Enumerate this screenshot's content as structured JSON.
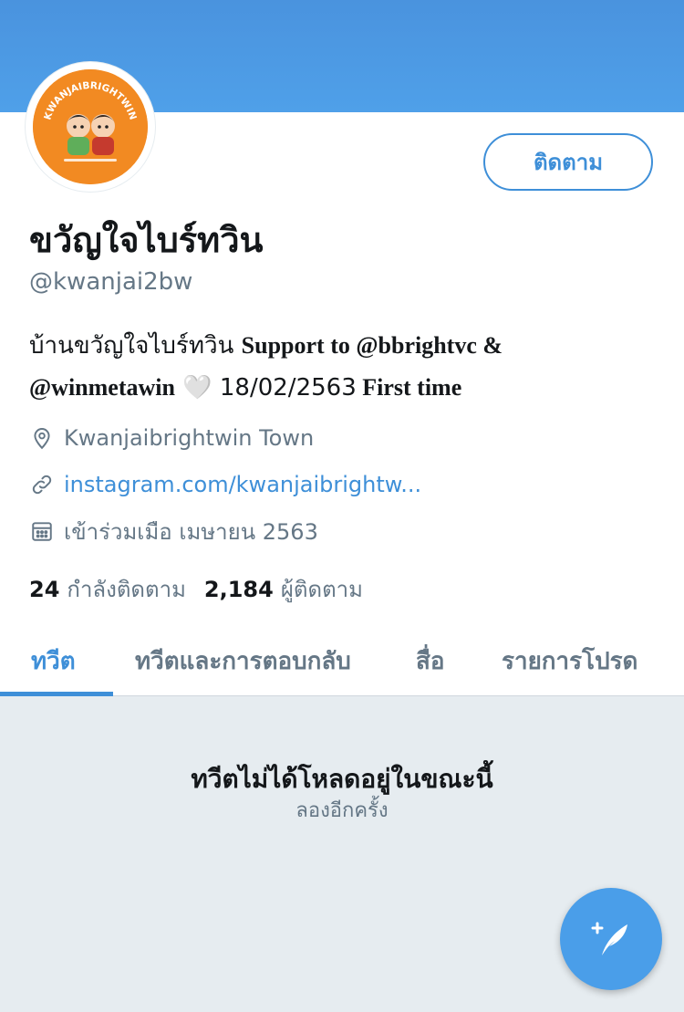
{
  "profile": {
    "display_name": "ขวัญใจไบร์ทวิน",
    "handle": "@kwanjai2bw",
    "follow_label": "ติดตาม",
    "avatar_text": "KWANJAIBRIGHTWIN",
    "bio": {
      "thai_part": "บ้านขวัญใจไบร์ทวิน ",
      "support_part": "Support to @bbrightvc &",
      "mention2": "@winmetawin",
      "heart": " 🤍 ",
      "date": "18/02/2563",
      "first_time": " First time"
    },
    "location": "Kwanjaibrightwin Town",
    "link": "instagram.com/kwanjaibrightw...",
    "joined": "เข้าร่วมเมือ เมษายน 2563",
    "following_count": "24",
    "following_label": "กำลังติดตาม",
    "followers_count": "2,184",
    "followers_label": "ผู้ติดตาม"
  },
  "tabs": [
    {
      "label": "ทวีต",
      "active": true
    },
    {
      "label": "ทวีตและการตอบกลับ",
      "active": false
    },
    {
      "label": "สื่อ",
      "active": false
    },
    {
      "label": "รายการโปรด",
      "active": false
    }
  ],
  "feed": {
    "empty_title": "ทวีตไม่ได้โหลดอยู่ในขณะนี้",
    "retry_label": "ลองอีกครั้ง"
  },
  "icons": {
    "location": "location-pin-icon",
    "link": "link-icon",
    "calendar": "calendar-icon",
    "compose": "compose-tweet-icon"
  },
  "colors": {
    "accent": "#3e8fd8",
    "banner": "#4a93de",
    "avatar_bg": "#f28a22",
    "feed_bg": "#e6ecf0",
    "muted": "#657786"
  }
}
